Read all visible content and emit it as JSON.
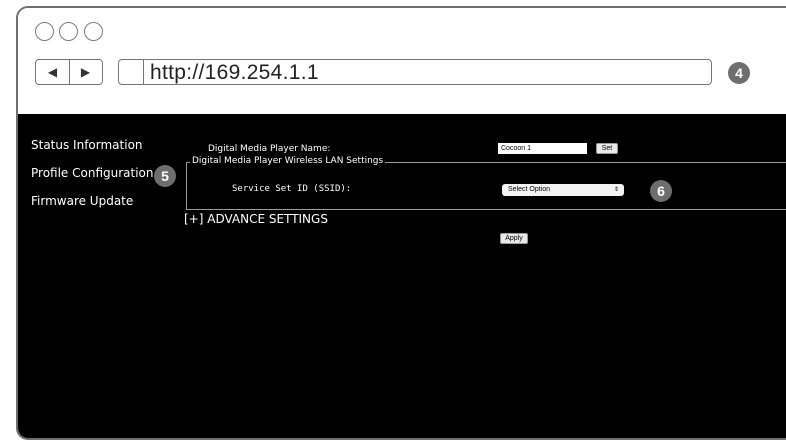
{
  "browser": {
    "url": "http://169.254.1.1",
    "back_icon": "◀",
    "forward_icon": "▶"
  },
  "callouts": {
    "address": "4",
    "sidebar": "5",
    "ssid": "6"
  },
  "sidebar": {
    "items": [
      {
        "label": "Status Information"
      },
      {
        "label": "Profile Configuration"
      },
      {
        "label": "Firmware Update"
      }
    ]
  },
  "form": {
    "player_name_label": "Digital Media Player Name:",
    "player_name_value": "Cocoon 1",
    "set_button": "Set",
    "wlan_legend": "Digital Media Player Wireless LAN Settings",
    "ssid_label": "Service Set ID (SSID):",
    "ssid_selected": "Select Option",
    "ssid_arrows": "⇕",
    "advanced_toggle": "[+] ADVANCE SETTINGS",
    "apply_button": "Apply"
  },
  "colors": {
    "content_bg": "#000000",
    "callout_bg": "#6e6e6e"
  }
}
